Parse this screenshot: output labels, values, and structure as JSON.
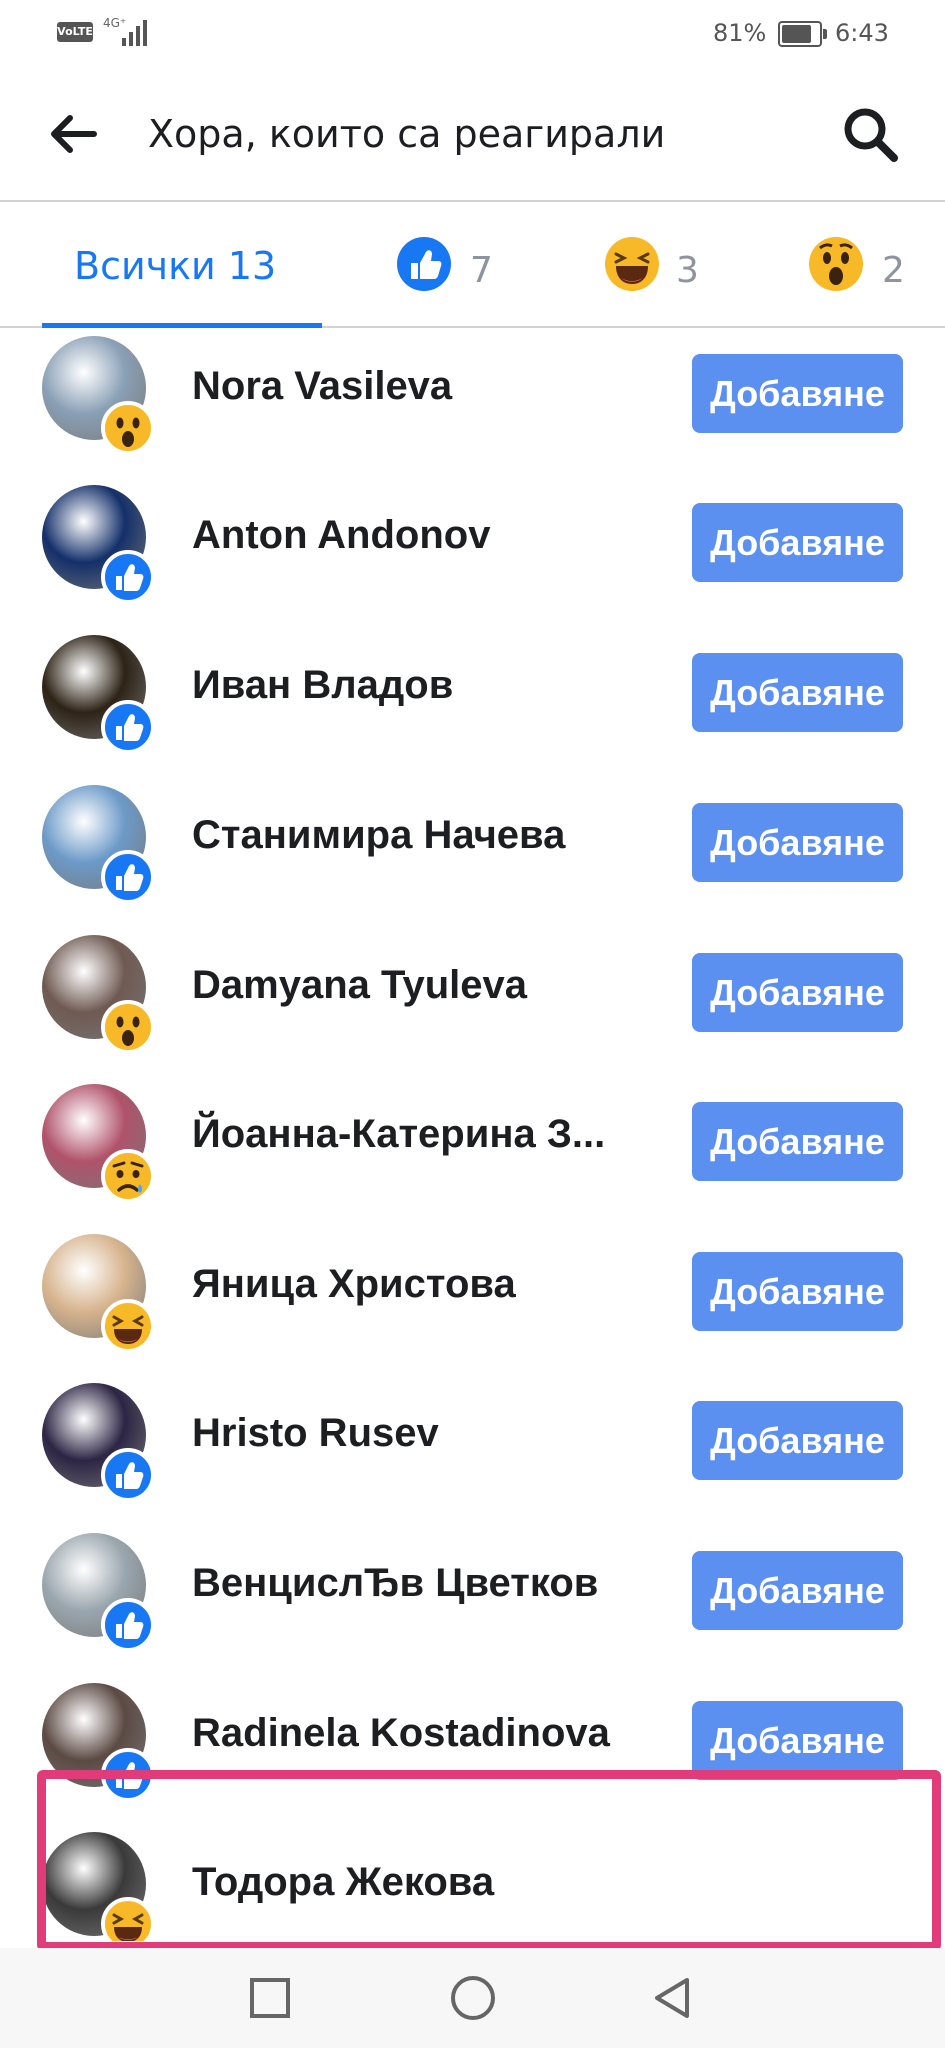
{
  "status_bar": {
    "volte": "VoLTE",
    "network": "4G⁺",
    "battery": "81%",
    "battery_level": 0.81,
    "time": "6:43"
  },
  "header": {
    "title": "Хора, които са реагирали",
    "back_icon": "arrow-left-icon",
    "search_icon": "search-icon"
  },
  "tabs": [
    {
      "label": "Всички 13",
      "selected": true
    },
    {
      "reaction": "like",
      "count": "7"
    },
    {
      "reaction": "haha",
      "count": "3"
    },
    {
      "reaction": "wow",
      "count": "2"
    }
  ],
  "add_label": "Добавяне",
  "people": [
    {
      "name": "Nora Vasileva",
      "reaction": "wow",
      "has_add": true,
      "avatar_color": "#8aa0b6"
    },
    {
      "name": "Anton Andonov",
      "reaction": "like",
      "has_add": true,
      "avatar_color": "#14306a"
    },
    {
      "name": "Иван Владов",
      "reaction": "like",
      "has_add": true,
      "avatar_color": "#2d2316"
    },
    {
      "name": "Станимира Начева",
      "reaction": "like",
      "has_add": true,
      "avatar_color": "#6c9ac8"
    },
    {
      "name": "Damyana Tyuleva",
      "reaction": "wow",
      "has_add": true,
      "avatar_color": "#6f5a52"
    },
    {
      "name": "Йоанна-Катерина З...",
      "reaction": "sad",
      "has_add": true,
      "avatar_color": "#b0526a"
    },
    {
      "name": "Яница Христова",
      "reaction": "haha",
      "has_add": true,
      "avatar_color": "#d7b48e"
    },
    {
      "name": "Hristo Rusev",
      "reaction": "like",
      "has_add": true,
      "avatar_color": "#2c2544"
    },
    {
      "name": "ВенцислЂв Цветков",
      "reaction": "like",
      "has_add": true,
      "avatar_color": "#9aa6ae"
    },
    {
      "name": "Radinela Kostadinova",
      "reaction": "like",
      "has_add": true,
      "avatar_color": "#5c4a44"
    },
    {
      "name": "Тодора Жекова",
      "reaction": "haha",
      "has_add": false,
      "avatar_color": "#3a3a3a",
      "highlighted": true
    }
  ],
  "colors": {
    "accent": "#1877f2",
    "button": "#5b8ff0",
    "highlight": "#e13c79"
  },
  "navbar": {
    "icons": [
      "square-icon",
      "circle-icon",
      "triangle-back-icon"
    ]
  }
}
